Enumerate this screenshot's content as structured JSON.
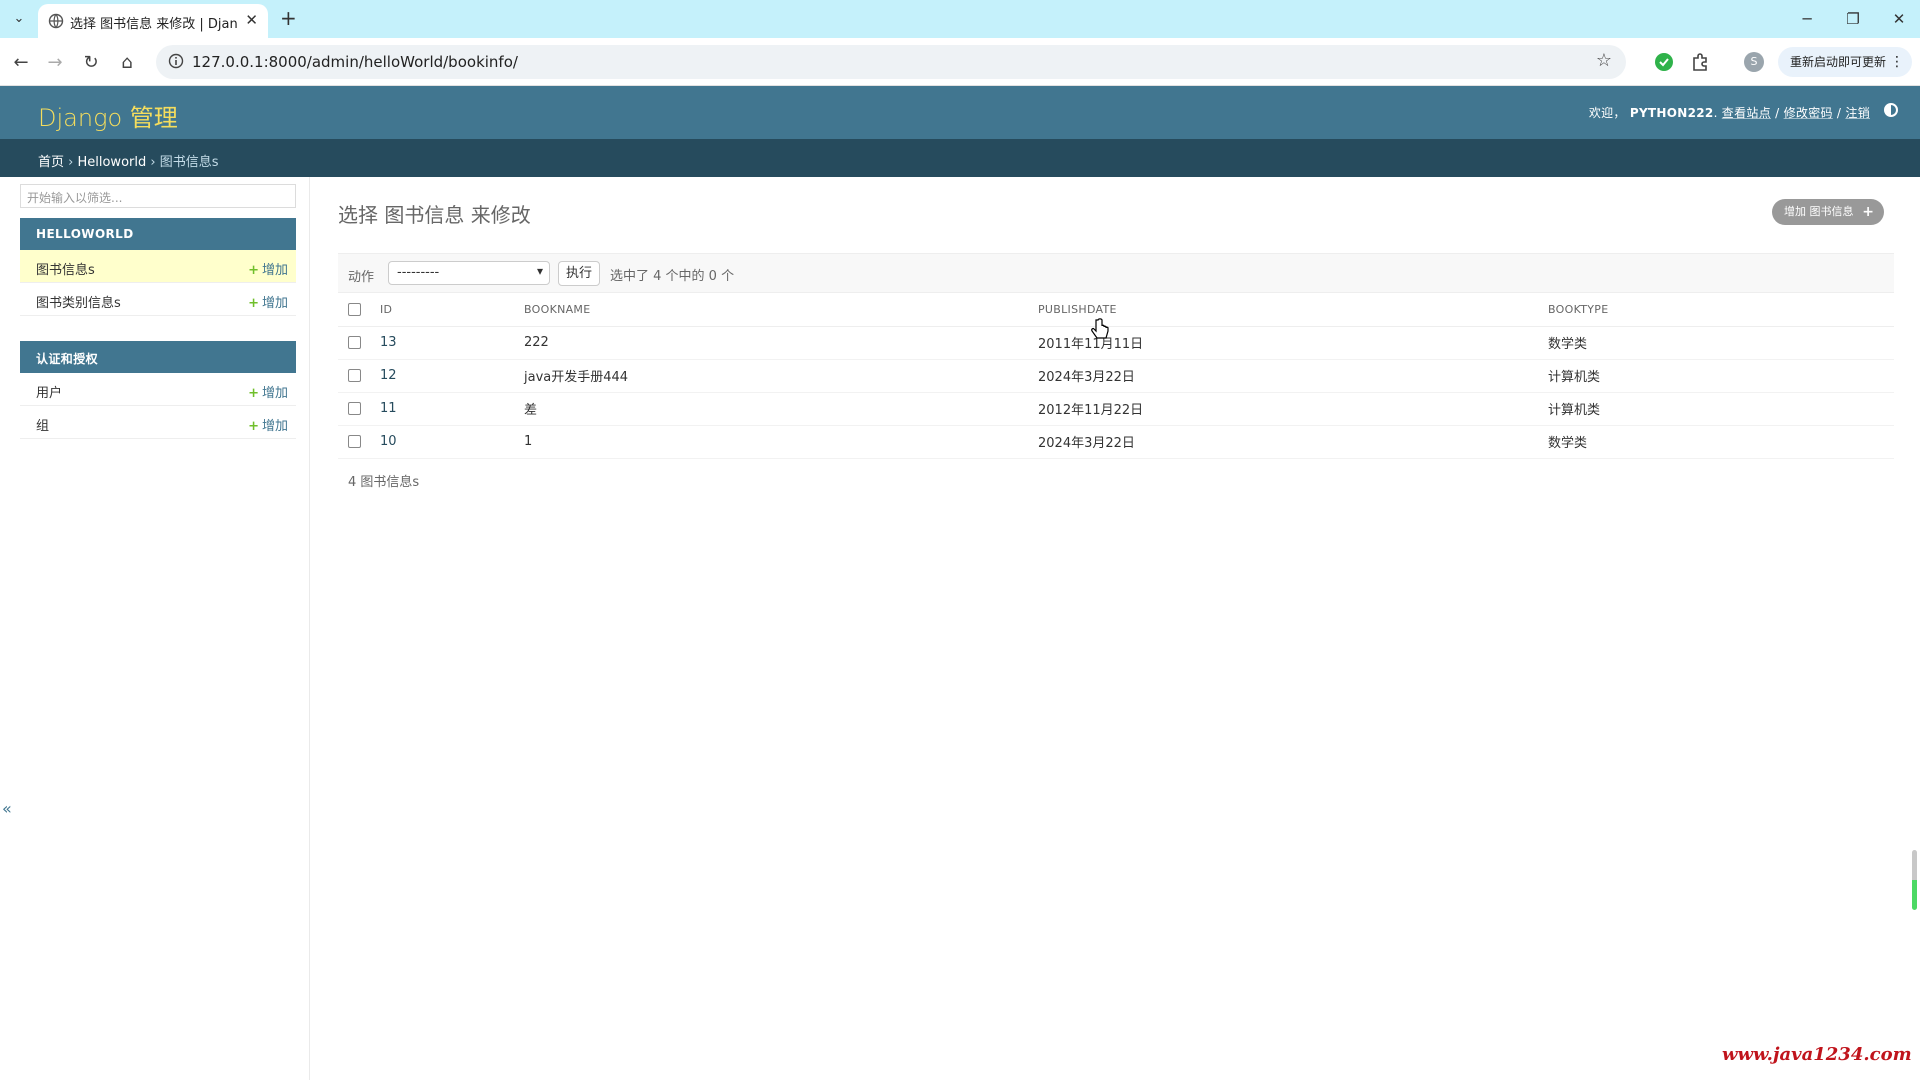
{
  "browser": {
    "tab_title": "选择 图书信息 来修改 | Django",
    "tab_list_icon": "chevron-down-icon",
    "url": "127.0.0.1:8000/admin/helloWorld/bookinfo/",
    "profile_initial": "S",
    "update_label": "重新启动即可更新",
    "window_controls": [
      "minimize-icon",
      "restore-icon",
      "close-icon"
    ]
  },
  "header": {
    "branding": "Django 管理",
    "welcome": "欢迎，",
    "username": "PYTHON222",
    "view_site": "查看站点",
    "change_password": "修改密码",
    "logout": "注销",
    "sep": " / ",
    "brand_color": "#f5dd5d",
    "header_color": "#417690"
  },
  "breadcrumbs": {
    "home": "首页",
    "sep": " › ",
    "app": "Helloworld",
    "current": "图书信息s"
  },
  "sidebar": {
    "filter_placeholder": "开始输入以筛选...",
    "modules": [
      {
        "caption": "HELLOWORLD",
        "models": [
          {
            "name": "图书信息s",
            "add": "增加",
            "current": true
          },
          {
            "name": "图书类别信息s",
            "add": "增加",
            "current": false
          }
        ]
      },
      {
        "caption": "认证和授权",
        "models": [
          {
            "name": "用户",
            "add": "增加",
            "current": false
          },
          {
            "name": "组",
            "add": "增加",
            "current": false
          }
        ]
      }
    ],
    "collapse_label": "«"
  },
  "content": {
    "title": "选择 图书信息 来修改",
    "add_button": "增加 图书信息",
    "actions": {
      "label": "动作",
      "selected_option": "---------",
      "go": "执行",
      "counter": "选中了 4 个中的 0 个"
    },
    "table": {
      "headers": [
        "ID",
        "BOOKNAME",
        "PUBLISHDATE",
        "BOOKTYPE"
      ],
      "rows": [
        {
          "id": "13",
          "bookname": "222",
          "publishdate": "2011年11月11日",
          "booktype": "数学类"
        },
        {
          "id": "12",
          "bookname": "java开发手册444",
          "publishdate": "2024年3月22日",
          "booktype": "计算机类"
        },
        {
          "id": "11",
          "bookname": "差",
          "publishdate": "2012年11月22日",
          "booktype": "计算机类"
        },
        {
          "id": "10",
          "bookname": "1",
          "publishdate": "2024年3月22日",
          "booktype": "数学类"
        }
      ]
    },
    "paginator": "4 图书信息s"
  },
  "watermark": "www.java1234.com"
}
